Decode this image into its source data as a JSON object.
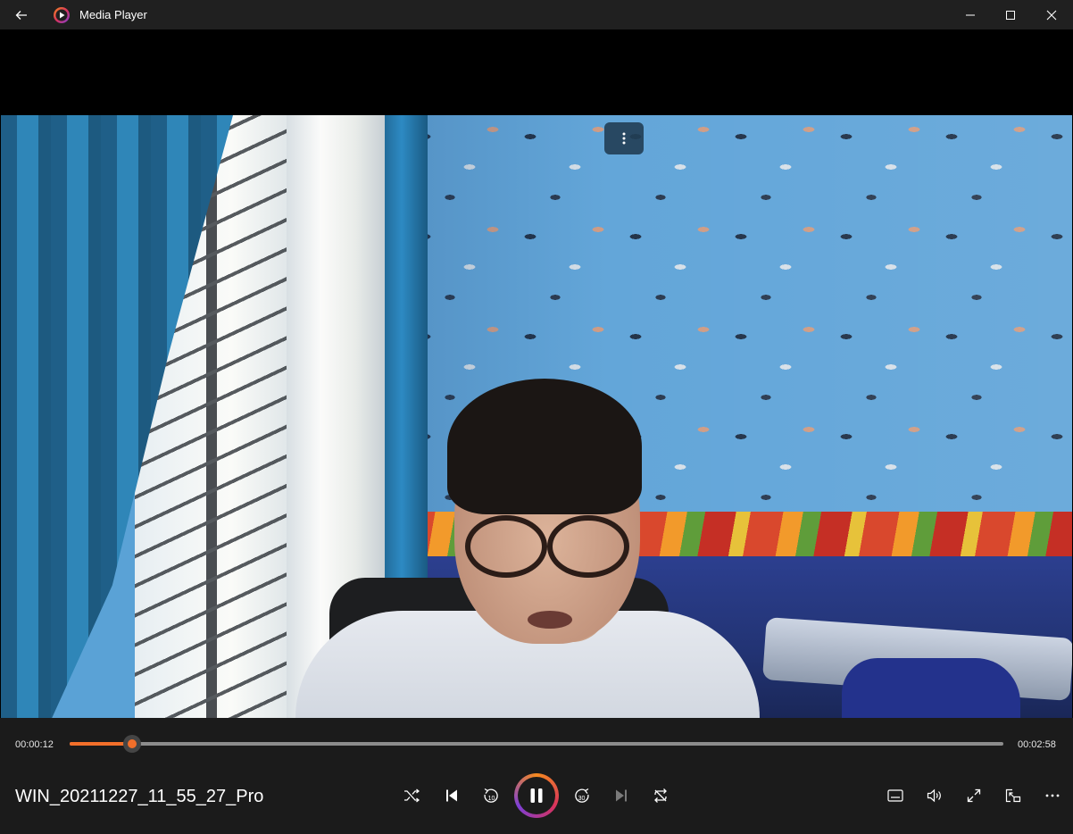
{
  "app": {
    "title": "Media Player",
    "accent": "#f26f2a"
  },
  "window_controls": {
    "icons": [
      "back-arrow-icon",
      "minimize-icon",
      "maximize-icon",
      "close-icon"
    ]
  },
  "video": {
    "overlay_icon": "more-vertical-icon"
  },
  "playback": {
    "current_time": "00:00:12",
    "total_time": "00:02:58",
    "progress_fraction": 0.067,
    "media_title": "WIN_20211227_11_55_27_Pro",
    "state": "playing"
  },
  "controls": {
    "icons": [
      "shuffle-icon",
      "previous-icon",
      "rewind-10-icon",
      "pause-icon",
      "forward-30-icon",
      "next-icon",
      "repeat-icon",
      "captions-icon",
      "volume-icon",
      "fullscreen-icon",
      "mini-player-icon",
      "more-horizontal-icon"
    ],
    "rewind_label": "10",
    "forward_label": "30"
  }
}
